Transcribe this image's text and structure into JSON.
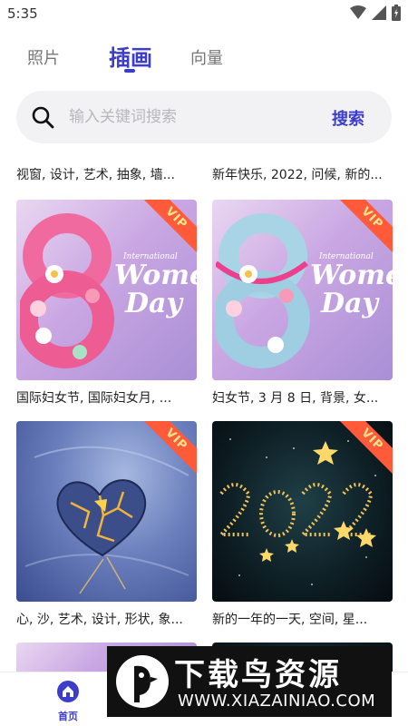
{
  "status_bar": {
    "time": "5:35"
  },
  "tabs": [
    {
      "label": "照片",
      "active": false
    },
    {
      "label": "插画",
      "active": true
    },
    {
      "label": "向量",
      "active": false
    }
  ],
  "search": {
    "placeholder": "输入关键词搜索",
    "button_label": "搜索"
  },
  "top_captions": [
    "视窗, 设计, 艺术, 抽象, 墙...",
    "新年快乐, 2022, 问候, 新的..."
  ],
  "cards": [
    {
      "caption": "国际妇女节, 国际妇女月, ...",
      "badge": "VIP",
      "art_text": [
        "International",
        "Women",
        "Day"
      ]
    },
    {
      "caption": "妇女节, 3 月 8 日, 背景, 女...",
      "badge": "VIP",
      "art_text": [
        "International",
        "Women",
        "Day"
      ]
    },
    {
      "caption": "心, 沙, 艺术, 设计, 形状, 象...",
      "badge": "VIP"
    },
    {
      "caption": "新的一年的一天, 空间, 星...",
      "badge": "VIP"
    }
  ],
  "bottom_nav": {
    "home_label": "首页"
  },
  "watermark": {
    "title": "下载鸟资源",
    "url": "WWW.XIAZAINIAO.COM"
  },
  "colors": {
    "accent": "#3d3dcc",
    "vip_ribbon": "#ff5a3a",
    "search_bg": "#f2f2f4"
  }
}
